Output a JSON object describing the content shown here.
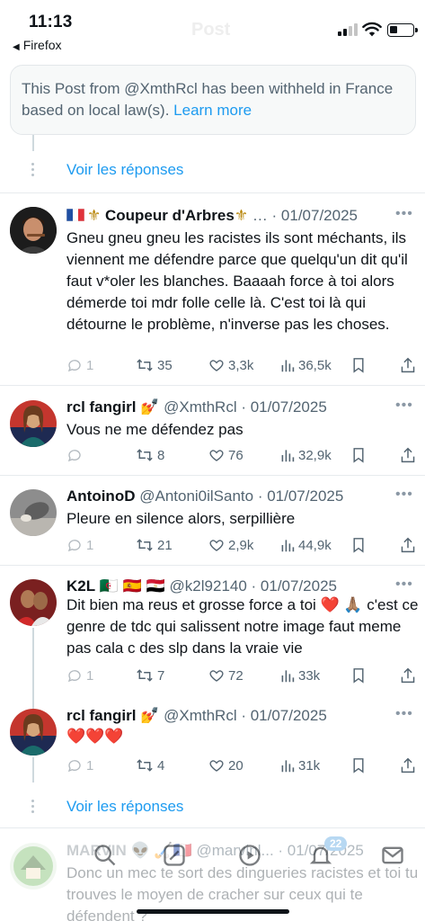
{
  "status_bar": {
    "time": "11:13",
    "back_app": "Firefox",
    "ghost_title": "Post"
  },
  "withheld": {
    "text": "This Post from @XmthRcl has been withheld in France based on local law(s).",
    "link": "Learn more"
  },
  "show_replies_label": "Voir les réponses",
  "tweets": [
    {
      "name": "Coupeur d'Arbres",
      "name_decoration": "⚜",
      "meta": "… · 01/07/2025",
      "text": "Gneu gneu gneu les racistes ils sont méchants, ils viennent me défendre parce que quelqu'un dit qu'il faut v*oler les blanches. Baaaah force à toi alors démerde toi mdr folle celle là. C'est toi là qui détourne le problème, n'inverse pas les choses.",
      "replies": "1",
      "reposts": "35",
      "likes": "3,3k",
      "views": "36,5k"
    },
    {
      "name": "rcl fangirl",
      "name_emoji": "💅",
      "meta": "@XmthRcl · 01/07/2025",
      "text": "Vous ne me défendez pas",
      "replies": "",
      "reposts": "8",
      "likes": "76",
      "views": "32,9k"
    },
    {
      "name": "AntoinoD",
      "meta": "@Antoni0ilSanto · 01/07/2025",
      "text": "Pleure en silence alors, serpillière",
      "replies": "1",
      "reposts": "21",
      "likes": "2,9k",
      "views": "44,9k"
    },
    {
      "name": "K2L",
      "name_emoji": "🇩🇿 🇪🇸 🇪🇬",
      "meta": "@k2l92140 · 01/07/2025",
      "text": "Dit bien ma reus et grosse force a toi ❤️ 🙏🏽 c'est ce genre de tdc qui salissent notre image faut meme pas cala c des slp dans la vraie vie",
      "replies": "1",
      "reposts": "7",
      "likes": "72",
      "views": "33k"
    },
    {
      "name": "rcl fangirl",
      "name_emoji": "💅",
      "meta": "@XmthRcl · 01/07/2025",
      "text": "❤️❤️❤️",
      "replies": "1",
      "reposts": "4",
      "likes": "20",
      "views": "31k"
    },
    {
      "name": "MARVIN",
      "name_emoji": "👽 🏑🇫🇷",
      "meta": "@marvinl... · 01/07/2025",
      "text": "Donc un mec te sort des dingueries racistes et toi tu trouves le moyen de cracher sur ceux qui te défendent ?"
    }
  ],
  "tab_bar": {
    "notification_count": "22"
  },
  "colors": {
    "link": "#1d9bf0",
    "meta": "#536471",
    "divider": "#e7ebee"
  }
}
